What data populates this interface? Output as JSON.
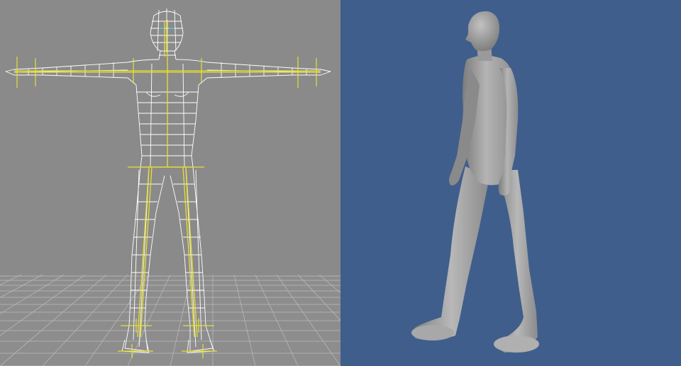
{
  "viewports": [
    {
      "view": "wireframe-with-skeleton",
      "background_color": "#8a8a8a",
      "floor_grid_color": "#c8c8c8",
      "mesh_color": "#ffffff",
      "skeleton_color": "#e8e030",
      "eye_highlight_color": "#40d8e8"
    },
    {
      "view": "shaded-walking-pose",
      "background_color": "#3f5e8c",
      "figure_color": "#b4b4b4",
      "figure_shadow_color": "#7c7c7c"
    }
  ]
}
